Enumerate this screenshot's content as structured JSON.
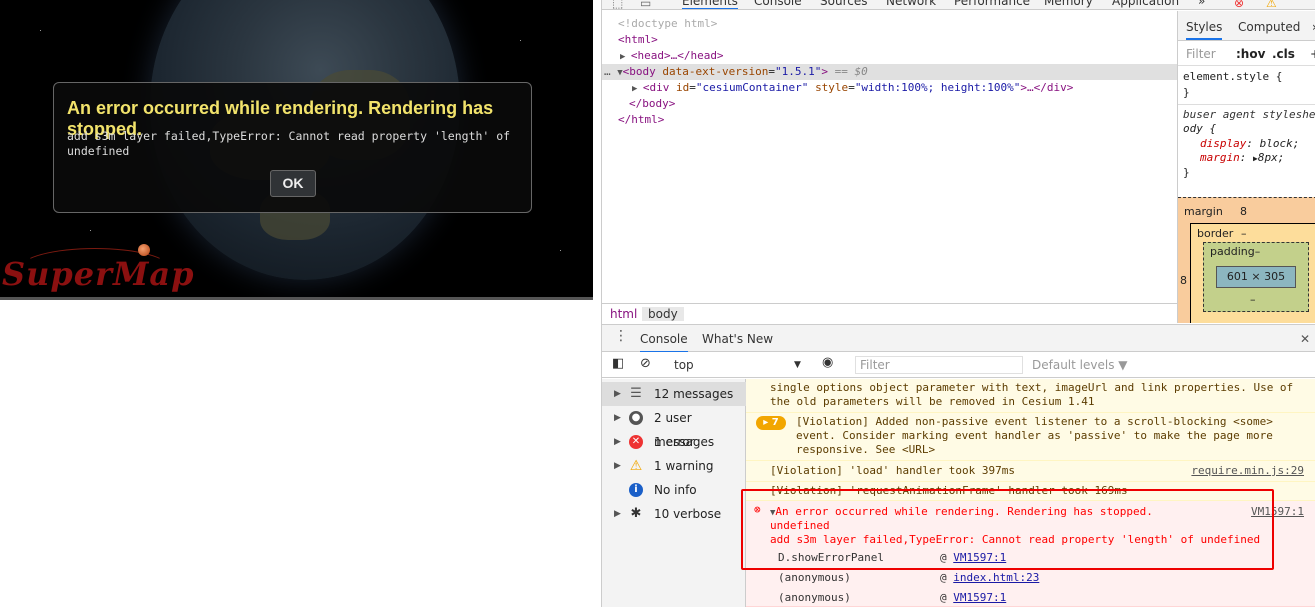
{
  "viewer": {
    "logo_text": "SuperMap",
    "error_panel": {
      "title": "An error occurred while rendering. Rendering has stopped.",
      "message": "add s3m layer failed,TypeError: Cannot read property 'length' of undefined",
      "ok_label": "OK"
    }
  },
  "devtools": {
    "tabs": [
      "Elements",
      "Console",
      "Sources",
      "Network",
      "Performance",
      "Memory",
      "Application"
    ],
    "more_tabs": "»",
    "elements": {
      "line1": "<!doctype html>",
      "line2": "<html>",
      "head_line": "<head>…</head>",
      "body_open": "<body",
      "body_attr": "data-ext-version",
      "body_val": "\"1.5.1\"",
      "body_eq": "== $0",
      "div_tag": "<div",
      "div_id_attr": "id",
      "div_id_val": "\"cesiumContainer\"",
      "div_style_attr": "style",
      "div_style_val": "\"width:100%; height:100%\"",
      "div_end": ">…</div>",
      "body_close": "</body>",
      "html_close": "</html>"
    },
    "styles": {
      "tabs": [
        "Styles",
        "Computed"
      ],
      "filter_placeholder": "Filter",
      "hov": ":hov",
      "cls": ".cls",
      "element_style": "element.style {",
      "close_brace": "}",
      "ua_label": "user agent styleshe",
      "ua_selector": "ody {",
      "display_prop": "display",
      "display_val": "block;",
      "margin_prop": "margin",
      "margin_val": "8px;",
      "box": {
        "margin_label": "margin",
        "margin_val": "8",
        "border_label": "border",
        "border_val": "–",
        "padding_label": "padding–",
        "content": "601 × 305",
        "left_margin": "8",
        "bottom_dash": "–"
      }
    },
    "breadcrumbs": [
      "html",
      "body"
    ],
    "drawer_tabs": [
      "Console",
      "What's New"
    ],
    "console_toolbar": {
      "context": "top",
      "filter_placeholder": "Filter",
      "levels": "Default levels ▼"
    },
    "sidebar": [
      {
        "label": "12 messages",
        "icon": "list-icon"
      },
      {
        "label": "2 user messages",
        "icon": "user-icon"
      },
      {
        "label": "1 error",
        "icon": "error-icon"
      },
      {
        "label": "1 warning",
        "icon": "warning-icon"
      },
      {
        "label": "No info",
        "icon": "info-icon"
      },
      {
        "label": "10 verbose",
        "icon": "bug-icon"
      }
    ],
    "log": {
      "warn1_line1": "single options object parameter with text, imageUrl and link properties. Use of",
      "warn1_line2": "the old parameters will be removed in Cesium 1.41",
      "violation_count": "7",
      "violation1_line1": "[Violation] Added non-passive event listener to a scroll-blocking <some>",
      "violation1_line2": "event. Consider marking event handler as 'passive' to make the page more",
      "violation1_line3": "responsive. See <URL>",
      "violation2": "[Violation] 'load' handler took 397ms",
      "violation2_src": "require.min.js:29",
      "violation3": "[Violation] 'requestAnimationFrame' handler took 169ms",
      "error_line1": "An error occurred while rendering. Rendering has stopped.",
      "error_src": "VM1597:1",
      "error_line2": "undefined",
      "error_line3": "add s3m layer failed,TypeError: Cannot read property 'length' of undefined",
      "stack": [
        {
          "fn": "D.showErrorPanel",
          "src": "VM1597:1"
        },
        {
          "fn": "(anonymous)",
          "src": "index.html:23"
        },
        {
          "fn": "(anonymous)",
          "src": "VM1597:1"
        }
      ]
    }
  },
  "colors": {
    "error_title": "#f2e36b",
    "error_red": "#ff0000",
    "highlight": "#ee0000"
  }
}
